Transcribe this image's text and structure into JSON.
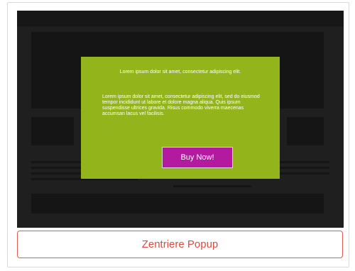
{
  "popup": {
    "heading": "Lorem ipsum dolor sit amet, consectetur adipiscing elit.",
    "body": "Lorem ipsum dolor sit amet, consectetur adipiscing elit, sed do eiusmod tempor incididunt ut labore et dolore magna aliqua. Quis ipsum suspendisse ultrices gravida. Risus commodo viverra maecenas accumsan lacus vel facilisis.",
    "button_label": "Buy Now!",
    "background_color": "#94b41c",
    "button_color": "#b31aa0"
  },
  "actions": {
    "center_popup_label": "Zentriere Popup",
    "accent_color": "#d94c3f"
  }
}
